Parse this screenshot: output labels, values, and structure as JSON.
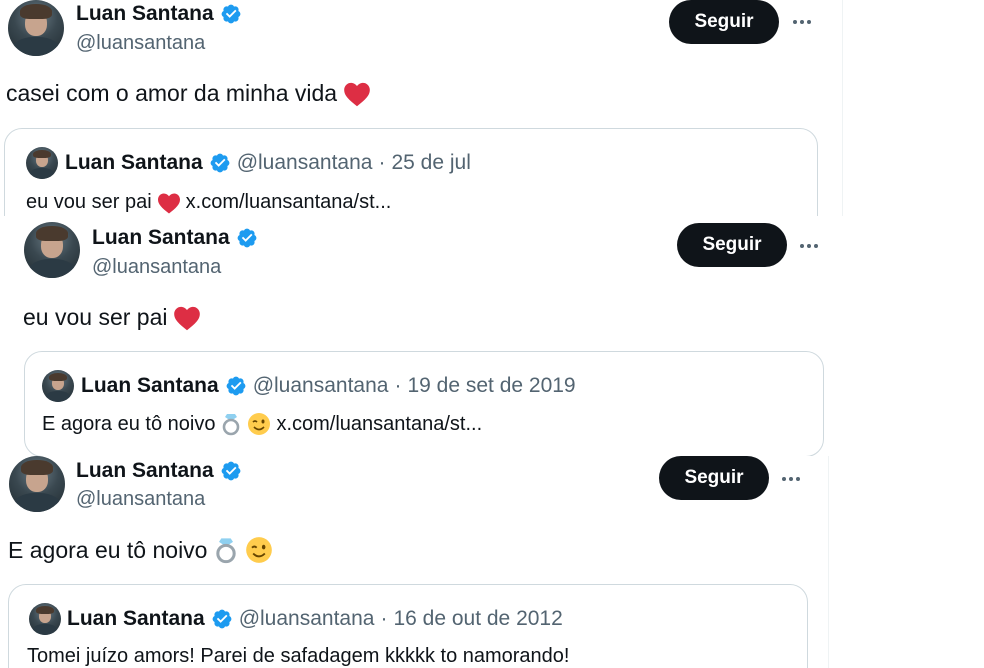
{
  "posts": [
    {
      "author": {
        "name": "Luan Santana",
        "handle": "@luansantana"
      },
      "follow_label": "Seguir",
      "text": "casei com o amor da minha vida",
      "text_emoji": "heart-icon",
      "quote": {
        "name": "Luan Santana",
        "handle": "@luansantana",
        "separator": "·",
        "date": "25 de jul",
        "text": "eu vou ser pai",
        "link": "x.com/luansantana/st..."
      }
    },
    {
      "author": {
        "name": "Luan Santana",
        "handle": "@luansantana"
      },
      "follow_label": "Seguir",
      "text": "eu vou ser pai",
      "text_emoji": "heart-icon",
      "quote": {
        "name": "Luan Santana",
        "handle": "@luansantana",
        "separator": "·",
        "date": "19 de set de 2019",
        "text": "E agora eu tô noivo",
        "link": "x.com/luansantana/st..."
      }
    },
    {
      "author": {
        "name": "Luan Santana",
        "handle": "@luansantana"
      },
      "follow_label": "Seguir",
      "text": "E agora eu tô noivo",
      "quote": {
        "name": "Luan Santana",
        "handle": "@luansantana",
        "separator": "·",
        "date": "16 de out de 2012",
        "text": "Tomei juízo amors! Parei de safadagem kkkkk to namorando!"
      }
    }
  ],
  "colors": {
    "verified": "#1d9bf0",
    "heart": "#dd2e44",
    "follow_bg": "#0f1419",
    "secondary_text": "#536471",
    "border": "#cfd9de"
  }
}
